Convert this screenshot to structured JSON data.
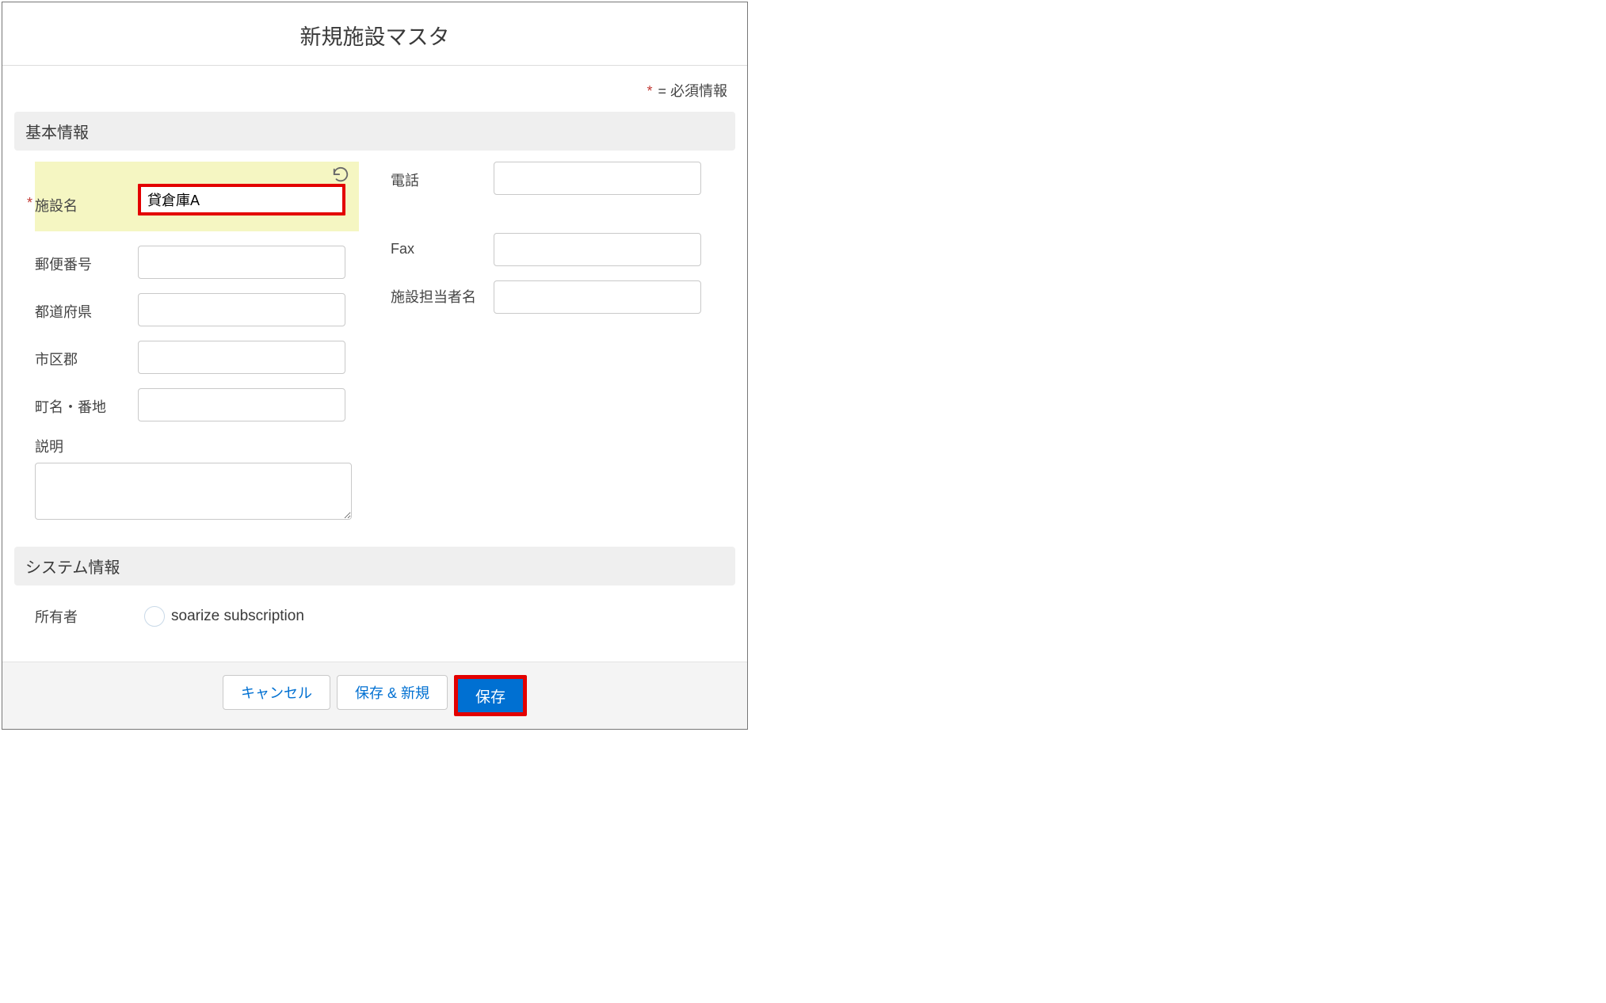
{
  "modal": {
    "title": "新規施設マスタ",
    "required_note_prefix": "*",
    "required_note_text": " = 必須情報"
  },
  "sections": {
    "basic": {
      "header": "基本情報"
    },
    "system": {
      "header": "システム情報"
    }
  },
  "fields": {
    "facility_name": {
      "label": "施設名",
      "value": "貸倉庫A"
    },
    "postal_code": {
      "label": "郵便番号",
      "value": ""
    },
    "prefecture": {
      "label": "都道府県",
      "value": ""
    },
    "city": {
      "label": "市区郡",
      "value": ""
    },
    "street": {
      "label": "町名・番地",
      "value": ""
    },
    "description": {
      "label": "説明",
      "value": ""
    },
    "phone": {
      "label": "電話",
      "value": ""
    },
    "fax": {
      "label": "Fax",
      "value": ""
    },
    "contact_name": {
      "label": "施設担当者名",
      "value": ""
    },
    "owner": {
      "label": "所有者",
      "value": "soarize subscription"
    }
  },
  "footer": {
    "cancel": "キャンセル",
    "save_and_new": "保存 & 新規",
    "save": "保存"
  }
}
